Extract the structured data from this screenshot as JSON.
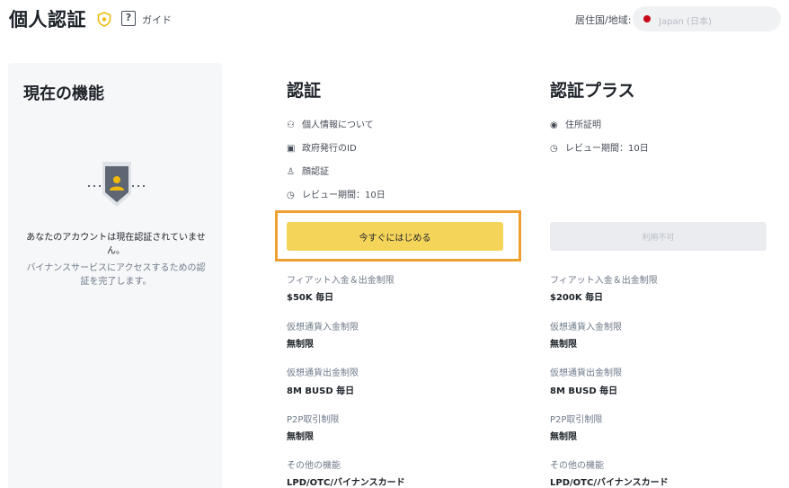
{
  "header": {
    "title": "個人認証",
    "guide_icon": "?",
    "guide_label": "ガイド",
    "residence_label": "居住国/地域:",
    "country_value": "Japan (日本)",
    "colors": {
      "country_dot": "#c9081a",
      "badge": "#f0b90b"
    }
  },
  "current": {
    "title": "現在の機能",
    "status": "あなたのアカウントは現在認証されていません。",
    "description": "バイナンスサービスにアクセスするための認証を完了します。"
  },
  "verified": {
    "title": "認証",
    "requirements": [
      {
        "icon": "person-info-icon",
        "glyph": "👤",
        "label": "個人情報について"
      },
      {
        "icon": "id-card-icon",
        "glyph": "▭",
        "label": "政府発行のID"
      },
      {
        "icon": "face-icon",
        "glyph": "♙",
        "label": "顔認証"
      },
      {
        "icon": "clock-icon",
        "glyph": "◷",
        "label": "レビュー期間：10日"
      }
    ],
    "button_label": "今すぐにはじめる",
    "button_color": "#f5d45a",
    "highlight_color": "#f0a030",
    "limits": [
      {
        "label": "フィアット入金＆出金制限",
        "value": "$50K 毎日"
      },
      {
        "label": "仮想通貨入金制限",
        "value": "無制限"
      },
      {
        "label": "仮想通貨出金制限",
        "value": "8M BUSD 毎日"
      },
      {
        "label": "P2P取引制限",
        "value": "無制限"
      },
      {
        "label": "その他の機能",
        "value": "LPD/OTC/バイナンスカード"
      }
    ]
  },
  "plus": {
    "title": "認証プラス",
    "requirements": [
      {
        "icon": "location-pin-icon",
        "glyph": "◉",
        "label": "住所証明"
      },
      {
        "icon": "clock-icon",
        "glyph": "◷",
        "label": "レビュー期間：10日"
      }
    ],
    "button_label": "利用不可",
    "limits": [
      {
        "label": "フィアット入金＆出金制限",
        "value": "$200K 毎日"
      },
      {
        "label": "仮想通貨入金制限",
        "value": "無制限"
      },
      {
        "label": "仮想通貨出金制限",
        "value": "8M BUSD 毎日"
      },
      {
        "label": "P2P取引制限",
        "value": "無制限"
      },
      {
        "label": "その他の機能",
        "value": "LPD/OTC/バイナンスカード"
      }
    ]
  }
}
